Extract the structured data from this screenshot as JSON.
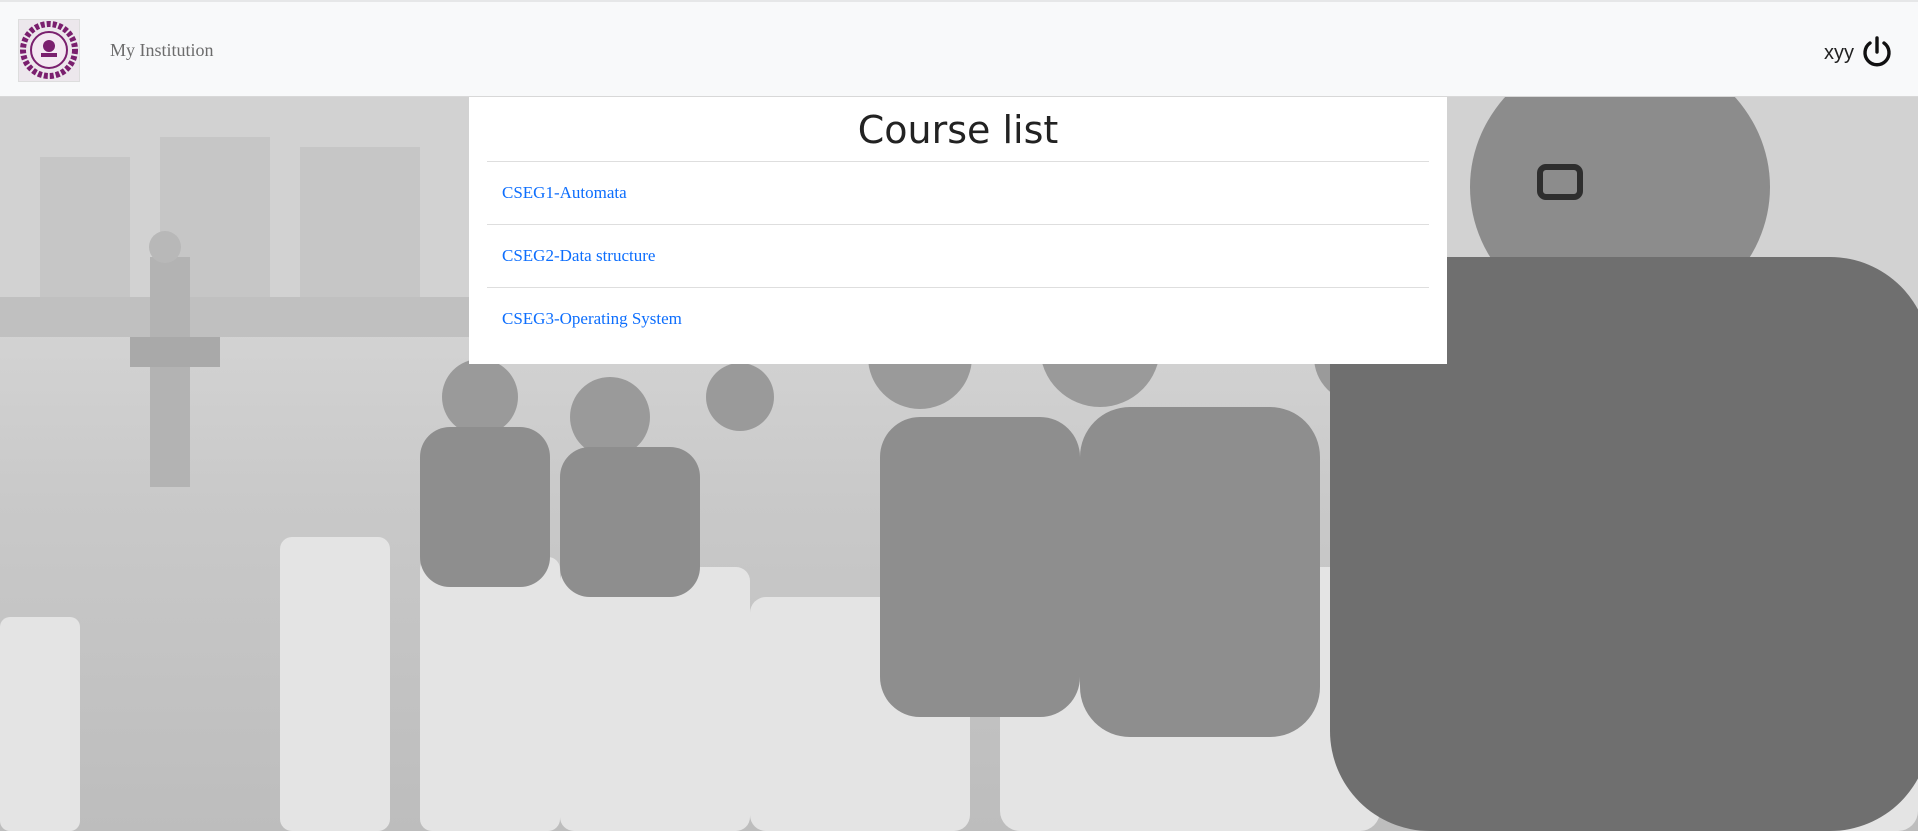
{
  "navbar": {
    "brand": "My Institution",
    "user_name": "xyy",
    "logo_icon": "institution-seal-logo",
    "logout_icon": "power-icon"
  },
  "main": {
    "title": "Course list",
    "courses": [
      {
        "label": "CSEG1-Automata"
      },
      {
        "label": "CSEG2-Data structure"
      },
      {
        "label": "CSEG3-Operating System"
      }
    ]
  },
  "colors": {
    "navbar_bg": "#f8f9fa",
    "link": "#0d6efd",
    "logo_purple": "#7a1f6e"
  }
}
